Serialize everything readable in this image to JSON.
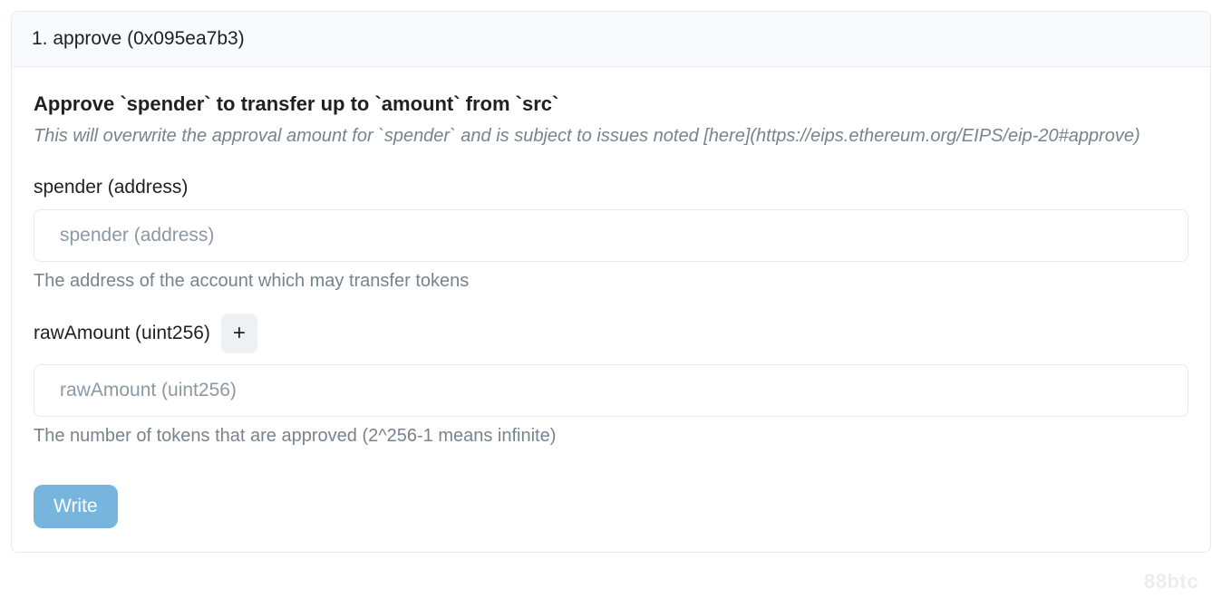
{
  "function": {
    "header": "1. approve (0x095ea7b3)",
    "desc_title": "Approve `spender` to transfer up to `amount` from `src`",
    "desc_sub": "This will overwrite the approval amount for `spender` and is subject to issues noted [here](https://eips.ethereum.org/EIPS/eip-20#approve)",
    "fields": {
      "spender": {
        "label": "spender (address)",
        "placeholder": "spender (address)",
        "help": "The address of the account which may transfer tokens"
      },
      "rawAmount": {
        "label": "rawAmount (uint256)",
        "placeholder": "rawAmount (uint256)",
        "plus": "+",
        "help": "The number of tokens that are approved (2^256-1 means infinite)"
      }
    },
    "write_label": "Write"
  },
  "watermark": "88btc"
}
